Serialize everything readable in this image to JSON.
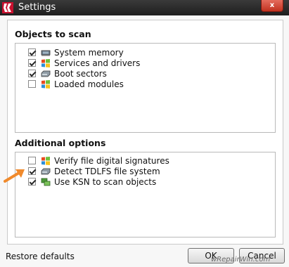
{
  "window": {
    "title": "Settings",
    "close_symbol": "x"
  },
  "objects_section": {
    "title": "Objects to scan",
    "items": [
      {
        "label": "System memory",
        "checked": true,
        "icon": "memory-chip-icon"
      },
      {
        "label": "Services and drivers",
        "checked": true,
        "icon": "windows-logo-icon"
      },
      {
        "label": "Boot sectors",
        "checked": true,
        "icon": "disk-drive-icon"
      },
      {
        "label": "Loaded modules",
        "checked": false,
        "icon": "windows-logo-icon"
      }
    ]
  },
  "additional_section": {
    "title": "Additional options",
    "items": [
      {
        "label": "Verify file digital signatures",
        "checked": false,
        "icon": "windows-logo-icon"
      },
      {
        "label": "Detect TDLFS file system",
        "checked": true,
        "icon": "disk-drive-icon"
      },
      {
        "label": "Use KSN to scan objects",
        "checked": true,
        "icon": "ksn-network-icon"
      }
    ]
  },
  "footer": {
    "restore_defaults": "Restore defaults",
    "ok_label": "OK",
    "cancel_label": "Cancel"
  },
  "watermark": "wRepairWin.com",
  "colors": {
    "titlebar": "#1e1e1e",
    "arrow": "#f08a2c",
    "close": "#c1311f"
  }
}
